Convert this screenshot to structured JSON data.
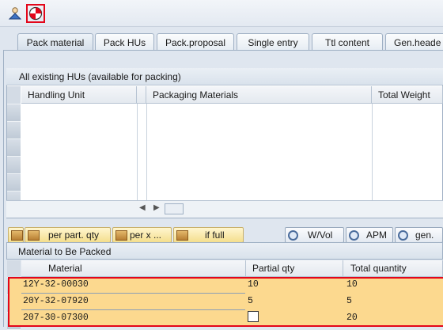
{
  "toolbar": {
    "icons": [
      "person-icon",
      "target-icon"
    ]
  },
  "tabs": [
    {
      "label": "Pack material"
    },
    {
      "label": "Pack HUs"
    },
    {
      "label": "Pack.proposal"
    },
    {
      "label": "Single entry"
    },
    {
      "label": "Ttl content"
    },
    {
      "label": "Gen.heade"
    }
  ],
  "hu_table": {
    "title": "All existing HUs (available for packing)",
    "columns": [
      "Handling Unit",
      "Packaging Materials",
      "Total Weight"
    ]
  },
  "buttons": {
    "per_part_qty": "per part. qty",
    "per_x": "per x ...",
    "if_full": "if full",
    "w_vol": "W/Vol",
    "apm": "APM",
    "gen": "gen."
  },
  "material_table": {
    "title": "Material to Be Packed",
    "columns": [
      "Material",
      "Partial qty",
      "Total quantity"
    ],
    "rows": [
      {
        "material": "12Y-32-00030",
        "partial_qty": "10",
        "total_qty": "10"
      },
      {
        "material": "20Y-32-07920",
        "partial_qty": "5",
        "total_qty": "5"
      },
      {
        "material": "207-30-07300",
        "partial_qty": "",
        "total_qty": "20"
      }
    ]
  }
}
